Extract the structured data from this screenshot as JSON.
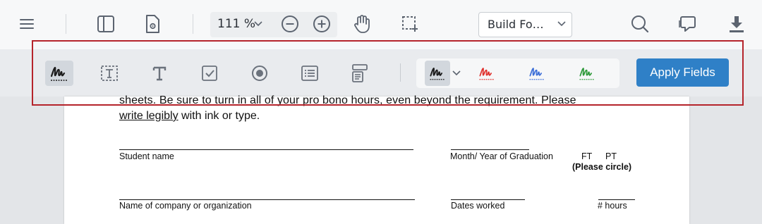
{
  "toolbar": {
    "zoom_value": "111 %",
    "build_select_value": "Build Fo…"
  },
  "icons": {
    "menu": "hamburger-menu-icon",
    "sidebar": "sidebar-panel-icon",
    "file_settings": "file-gear-icon",
    "zoom_dropdown": "chevron-down-icon",
    "zoom_out": "zoom-out-icon",
    "zoom_in": "zoom-in-icon",
    "pan": "hand-icon",
    "select": "selection-rectangle-icon",
    "build_dropdown": "chevron-down-icon",
    "search": "search-icon",
    "comments": "comment-icon",
    "download": "download-icon"
  },
  "form_fields": {
    "tools": [
      "signature-field",
      "text-field",
      "free-text",
      "checkbox",
      "radio-button",
      "list-box",
      "dropdown"
    ],
    "signature_colors": [
      "#1c1c1c",
      "#e0312d",
      "#3d6fd8",
      "#2e9a3a"
    ],
    "apply_label": "Apply Fields"
  },
  "colors": {
    "accent": "#2f80c7",
    "highlight": "#b5242b"
  },
  "document": {
    "para_cut": "sheets. Be sure to turn in all of your pro bono hours, even beyond the requirement. Please",
    "para2_link": "write legibly",
    "para2_rest": " with ink or type.",
    "student_name_label": "Student name",
    "graduation_label": "Month/ Year of Graduation",
    "ft_label": "FT",
    "pt_label": "PT",
    "please_circle": "(Please circle)",
    "company_label": "Name of company or organization",
    "dates_label": "Dates worked",
    "hours_label": "# hours"
  }
}
